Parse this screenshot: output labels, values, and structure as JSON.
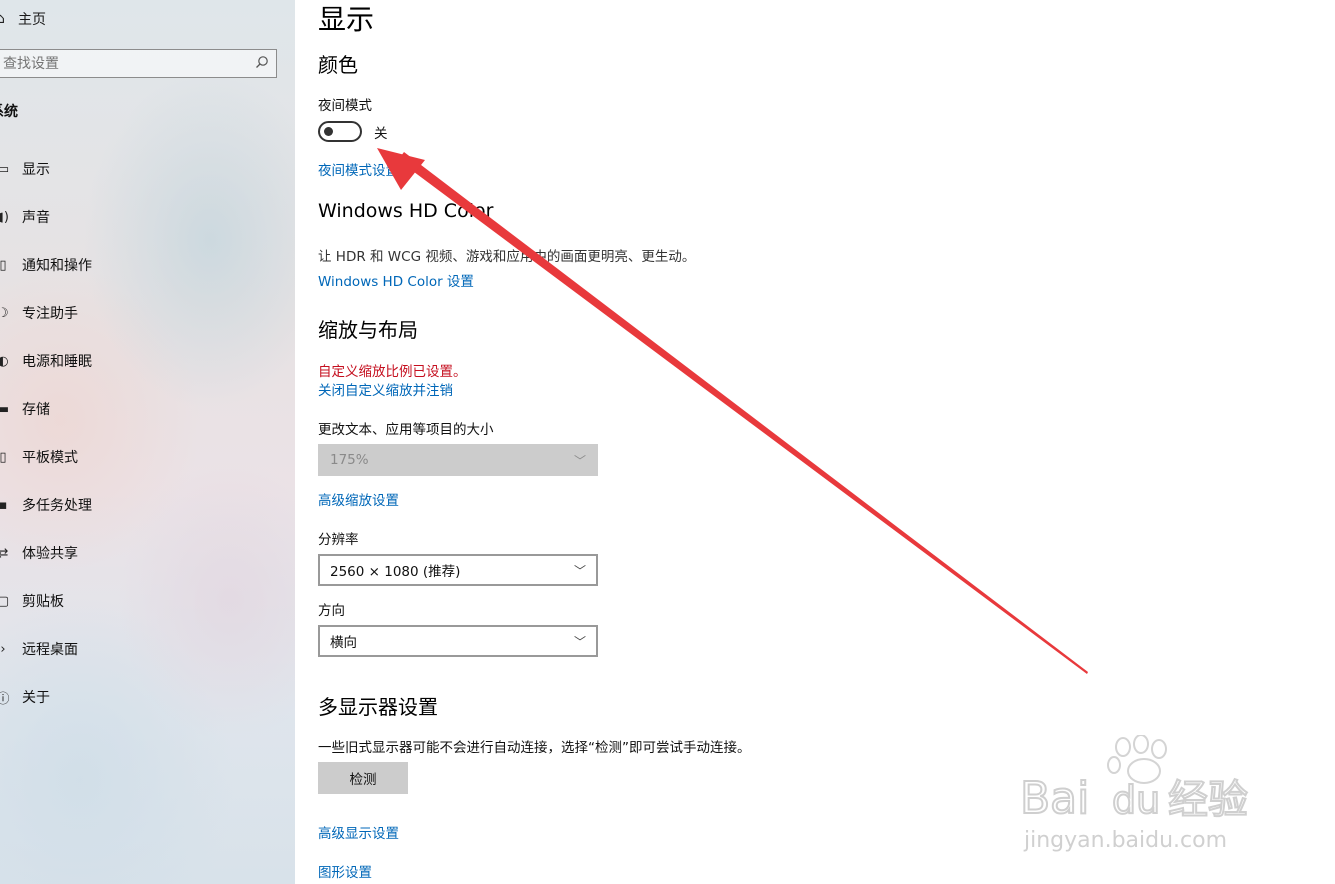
{
  "sidebar": {
    "home": {
      "label": "主页"
    },
    "search": {
      "placeholder": "查找设置"
    },
    "section_title": "系统",
    "items": [
      {
        "label": "显示",
        "icon": "monitor-icon"
      },
      {
        "label": "声音",
        "icon": "speaker-icon"
      },
      {
        "label": "通知和操作",
        "icon": "notification-icon"
      },
      {
        "label": "专注助手",
        "icon": "moon-icon"
      },
      {
        "label": "电源和睡眠",
        "icon": "power-icon"
      },
      {
        "label": "存储",
        "icon": "storage-icon"
      },
      {
        "label": "平板模式",
        "icon": "tablet-icon"
      },
      {
        "label": "多任务处理",
        "icon": "multitask-icon"
      },
      {
        "label": "体验共享",
        "icon": "share-icon"
      },
      {
        "label": "剪贴板",
        "icon": "clipboard-icon"
      },
      {
        "label": "远程桌面",
        "icon": "remote-icon"
      },
      {
        "label": "关于",
        "icon": "info-icon"
      }
    ]
  },
  "main": {
    "title": "显示",
    "color": {
      "heading": "颜色",
      "night_mode_label": "夜间模式",
      "night_mode_state": "关",
      "night_mode_on": false,
      "night_mode_link": "夜间模式设置"
    },
    "hdr": {
      "heading": "Windows HD Color",
      "description": "让 HDR 和 WCG 视频、游戏和应用中的画面更明亮、更生动。",
      "link": "Windows HD Color 设置"
    },
    "scale": {
      "heading": "缩放与布局",
      "warning": "自定义缩放比例已设置。",
      "signout_link": "关闭自定义缩放并注销",
      "size_label": "更改文本、应用等项目的大小",
      "size_value": "175%",
      "advanced_link": "高级缩放设置",
      "resolution_label": "分辨率",
      "resolution_value": "2560 × 1080 (推荐)",
      "orientation_label": "方向",
      "orientation_value": "横向"
    },
    "multi": {
      "heading": "多显示器设置",
      "description": "一些旧式显示器可能不会进行自动连接，选择“检测”即可尝试手动连接。",
      "detect_button": "检测",
      "advanced_display_link": "高级显示设置",
      "graphics_link": "图形设置"
    }
  },
  "annotation": {
    "arrow_color": "#e8393c"
  },
  "watermark": {
    "brand": "Bai du 经验",
    "url": "jingyan.baidu.com"
  }
}
